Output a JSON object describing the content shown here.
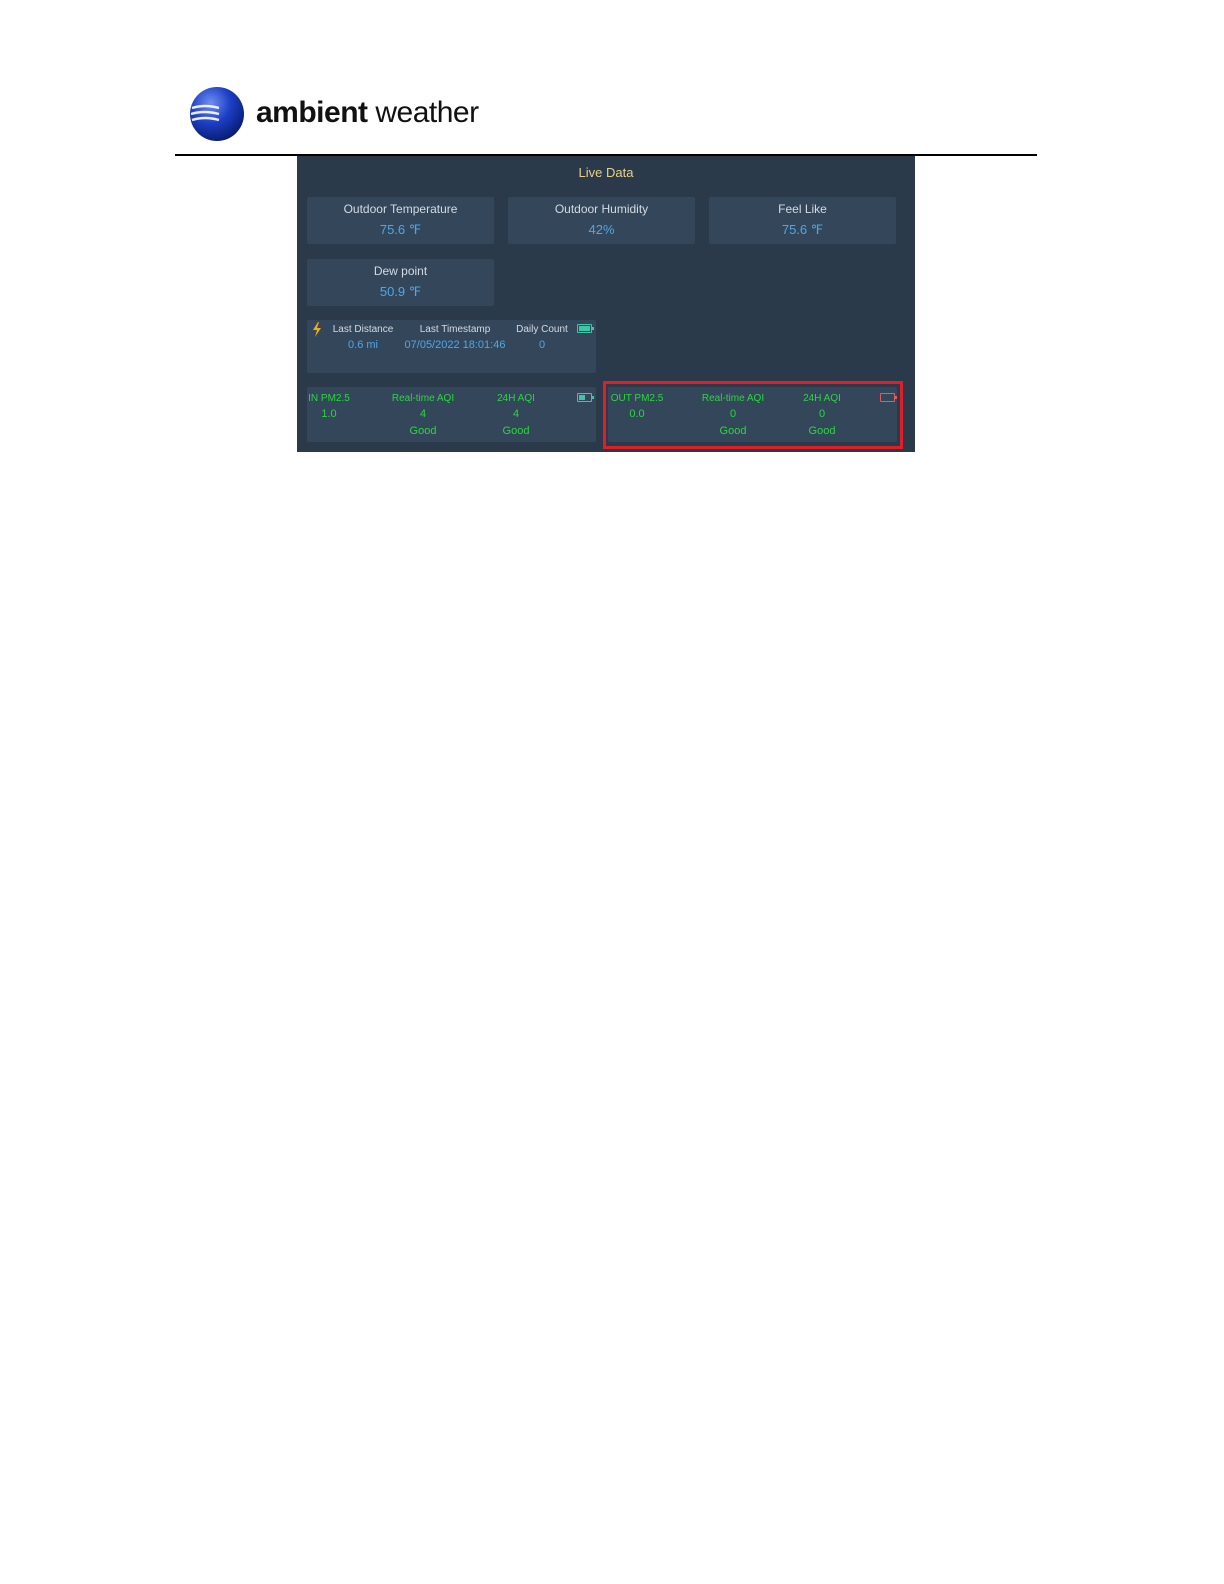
{
  "brand": {
    "name_bold": "ambient",
    "name_regular": " weather"
  },
  "panel": {
    "title": "Live Data",
    "cards": [
      {
        "label": "Outdoor Temperature",
        "value": "75.6 ℉"
      },
      {
        "label": "Outdoor Humidity",
        "value": "42%"
      },
      {
        "label": "Feel Like",
        "value": "75.6 ℉"
      },
      {
        "label": "Dew point",
        "value": "50.9 ℉"
      }
    ],
    "lightning": {
      "icon": "lightning-icon",
      "distance_label": "Last Distance",
      "distance_value": "0.6 mi",
      "timestamp_label": "Last Timestamp",
      "timestamp_value": "07/05/2022 18:01:46",
      "count_label": "Daily Count",
      "count_value": "0",
      "battery_level": 1.0
    },
    "indoor_pm": {
      "pm_label": "IN PM2.5",
      "pm_value": "1.0",
      "rt_label": "Real-time AQI",
      "rt_value": "4",
      "rt_status": "Good",
      "aqi24_label": "24H AQI",
      "aqi24_value": "4",
      "aqi24_status": "Good",
      "battery_level": 0.5
    },
    "outdoor_pm": {
      "pm_label": "OUT PM2.5",
      "pm_value": "0.0",
      "rt_label": "Real-time AQI",
      "rt_value": "0",
      "rt_status": "Good",
      "aqi24_label": "24H AQI",
      "aqi24_value": "0",
      "aqi24_status": "Good",
      "battery_level": 0.0
    }
  },
  "colors": {
    "panel_bg": "#2b3a4a",
    "card_bg": "#34475a",
    "value_blue": "#4fa6ea",
    "aqi_green": "#27d83c",
    "title_gold": "#e8cf86",
    "highlight_red": "#e01e2a"
  }
}
